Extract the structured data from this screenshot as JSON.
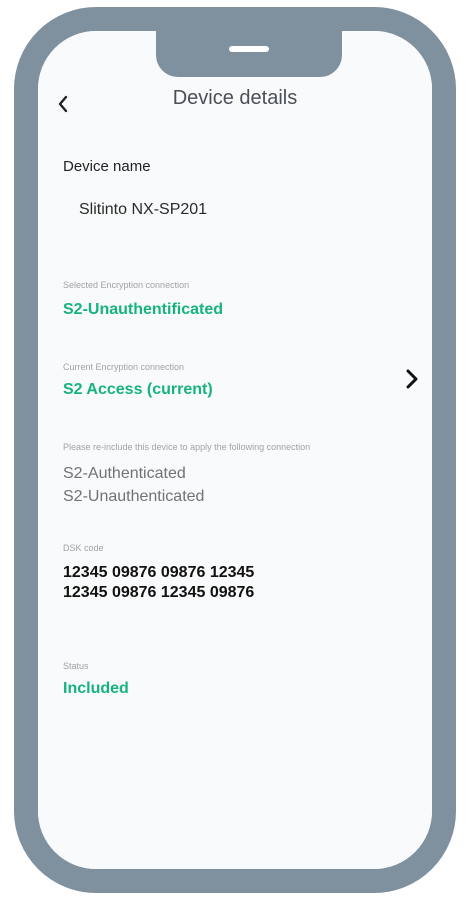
{
  "header": {
    "title": "Device details",
    "back_icon": "chevron-left-icon"
  },
  "device_name": {
    "label": "Device name",
    "value": "Slitinto NX-SP201"
  },
  "selected_encryption": {
    "label": "Selected Encryption connection",
    "value": "S2-Unauthentificated"
  },
  "current_encryption": {
    "label": "Current Encryption connection",
    "value": "S2 Access (current)",
    "arrow_icon": "chevron-right-icon"
  },
  "reinclude": {
    "notice": "Please re-include this device to apply the following connection",
    "options": [
      "S2-Authenticated",
      "S2-Unauthenticated"
    ]
  },
  "dsk": {
    "label": "DSK code",
    "lines": [
      "12345 09876 09876 12345",
      "12345 09876 12345 09876"
    ]
  },
  "status": {
    "label": "Status",
    "value": "Included"
  },
  "colors": {
    "accent_green": "#16b37e",
    "phone_frame": "#7f909f"
  }
}
